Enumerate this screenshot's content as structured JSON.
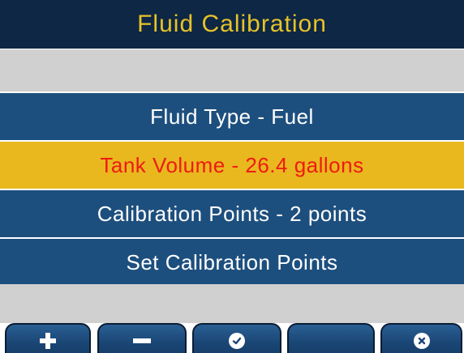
{
  "header": {
    "title": "Fluid Calibration"
  },
  "menu": {
    "items": [
      {
        "label": "Fluid Type - Fuel",
        "selected": false
      },
      {
        "label": "Tank Volume - 26.4 gallons",
        "selected": true
      },
      {
        "label": "Calibration Points - 2 points",
        "selected": false
      },
      {
        "label": "Set Calibration Points",
        "selected": false
      }
    ]
  },
  "softkeys": [
    {
      "icon": "plus-icon"
    },
    {
      "icon": "minus-icon"
    },
    {
      "icon": "check-icon"
    },
    {
      "icon": ""
    },
    {
      "icon": "cancel-icon"
    }
  ],
  "colors": {
    "title_bg": "#0d2744",
    "title_text": "#e8c22a",
    "menu_bg": "#1d4f7e",
    "menu_text": "#ffffff",
    "selected_bg": "#e8b81e",
    "selected_text": "#ee1b12",
    "blank_band": "#d0d0d0"
  }
}
